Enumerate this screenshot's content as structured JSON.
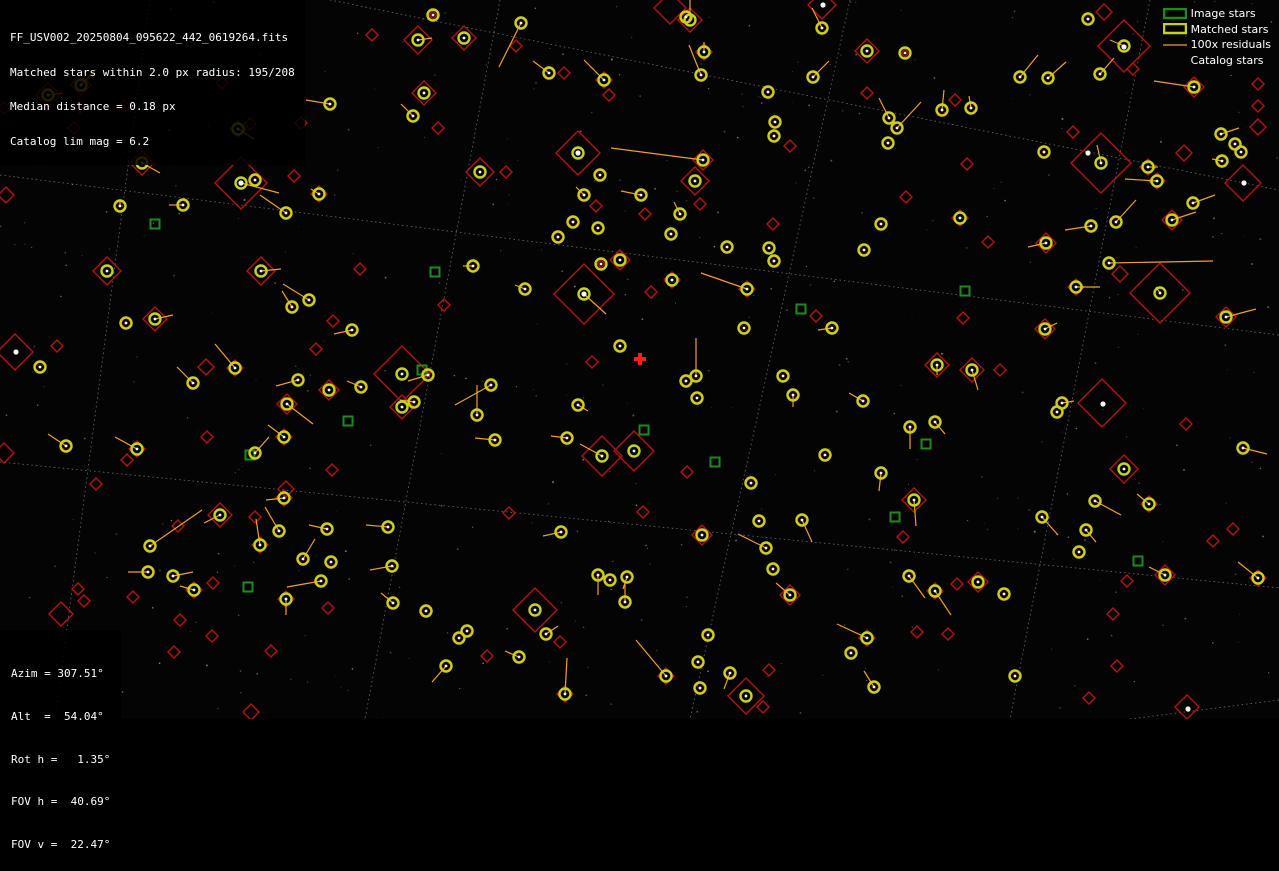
{
  "overlay_info": {
    "lines": [
      "FF_USV002_20250804_095622_442_0619264.fits",
      "Matched stars within 2.0 px radius: 195/208",
      "Median distance = 0.18 px",
      "Catalog lim mag = 6.2"
    ]
  },
  "legend": {
    "items": [
      {
        "label": "Image stars",
        "kind": "image"
      },
      {
        "label": "Matched stars",
        "kind": "matched"
      },
      {
        "label": "100x residuals",
        "kind": "residual"
      },
      {
        "label": "Catalog stars",
        "kind": "catalog"
      }
    ]
  },
  "pointing": {
    "lines": [
      "Azim = 307.51°",
      "Alt  =  54.04°",
      "Rot h =   1.35°",
      "FOV h =  40.69°",
      "FOV v =  22.47°"
    ]
  },
  "colors": {
    "image_star": "#1e8a1e",
    "matched_star": "#c8d21e",
    "residual": "#f0a028",
    "catalog_star": "#b41414",
    "center_marker": "#ff1e1e",
    "grid": "#6e6e6e"
  },
  "icons": {
    "center": "crosshair-icon"
  }
}
